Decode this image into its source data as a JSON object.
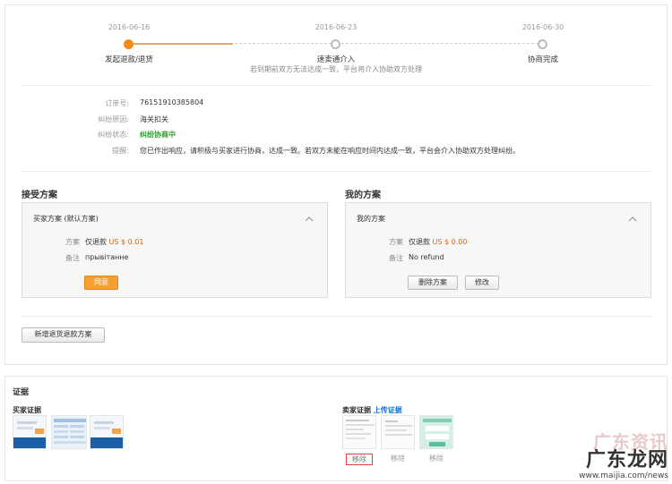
{
  "progress": {
    "steps": [
      {
        "date": "2016-06-16",
        "label": "发起退款/退货"
      },
      {
        "date": "2016-06-23",
        "label": "速卖通介入"
      },
      {
        "date": "2016-06-30",
        "label": "协商完成"
      }
    ],
    "note": "若到期前双方无法达成一致，平台将介入协助双方处理"
  },
  "dispute": {
    "order_no_label": "订单号:",
    "order_no": "76151910385804",
    "reason_label": "纠纷原因:",
    "reason": "海关扣关",
    "status_label": "纠纷状态:",
    "status": "纠纷协商中",
    "reminder_label": "提醒:",
    "reminder": "您已作出响应，请积极与买家进行协商，达成一致。若双方未能在响应时间内达成一致，平台会介入协助双方处理纠纷。"
  },
  "accept_section": {
    "title": "接受方案",
    "box_title": "买家方案 (默认方案)",
    "plan_label": "方案",
    "plan_prefix": "仅退款",
    "plan_amount": "US $ 0.01",
    "note_label": "备注",
    "note": "прывітанне",
    "agree_button": "同意"
  },
  "my_section": {
    "title": "我的方案",
    "box_title": "我的方案",
    "plan_label": "方案",
    "plan_prefix": "仅退款",
    "plan_amount": "US $ 0.00",
    "note_label": "备注",
    "note": "No refund",
    "delete_button": "删除方案",
    "edit_button": "修改"
  },
  "add_plan_button": "新增退货退款方案",
  "evidence": {
    "title": "证据",
    "buyer_label": "买家证据",
    "seller_label": "卖家证据",
    "upload_link": "上传证据",
    "remove_label": "移除"
  },
  "watermark": {
    "top": "广东资讯",
    "main": "广东龙网",
    "url": "www.maijia.com/news"
  },
  "colors": {
    "accent": "#f28c1e",
    "status_green": "#2a9d2a",
    "link": "#1a6fd1"
  }
}
